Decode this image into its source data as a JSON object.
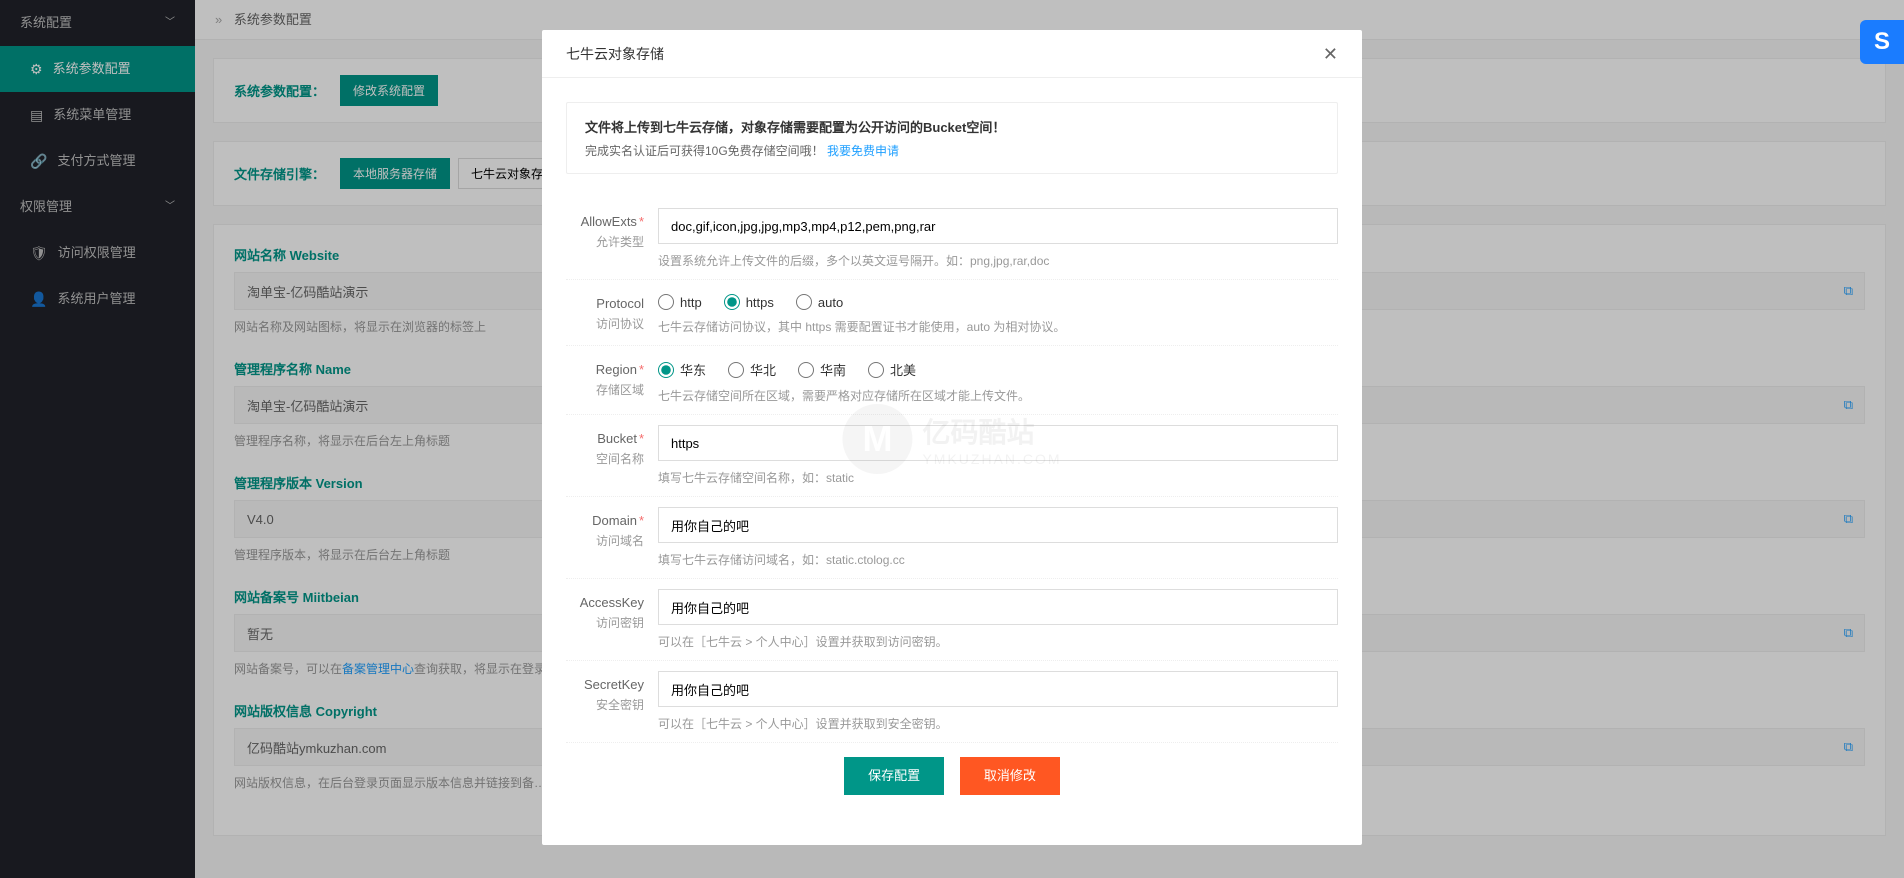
{
  "sidebar": {
    "group1": "系统配置",
    "items1": [
      "系统参数配置",
      "系统菜单管理",
      "支付方式管理"
    ],
    "group2": "权限管理",
    "items2": [
      "访问权限管理",
      "系统用户管理"
    ]
  },
  "breadcrumb": "系统参数配置",
  "panel1": {
    "label": "系统参数配置：",
    "btn": "修改系统配置"
  },
  "panel2": {
    "label": "文件存储引擎：",
    "btn1": "本地服务器存储",
    "btn2": "七牛云对象存储"
  },
  "fields": [
    {
      "label": "网站名称 Website",
      "value": "淘单宝-亿码酷站演示",
      "desc": "网站名称及网站图标，将显示在浏览器的标签上"
    },
    {
      "label": "管理程序名称 Name",
      "value": "淘单宝-亿码酷站演示",
      "desc": "管理程序名称，将显示在后台左上角标题"
    },
    {
      "label": "管理程序版本 Version",
      "value": "V4.0",
      "desc": "管理程序版本，将显示在后台左上角标题"
    },
    {
      "label": "网站备案号 Miitbeian",
      "value": "暂无",
      "desc": "网站备案号，可以在",
      "descLink": "备案管理中心",
      "desc2": "查询获取，将显示在登录……"
    },
    {
      "label": "网站版权信息 Copyright",
      "value": "亿码酷站ymkuzhan.com",
      "desc": "网站版权信息，在后台登录页面显示版本信息并链接到备……"
    }
  ],
  "modal": {
    "title": "七牛云对象存储",
    "info1": "文件将上传到七牛云存储，对象存储需要配置为公开访问的Bucket空间！",
    "info2a": "完成实名认证后可获得10G免费存储空间哦！",
    "info2b": "我要免费申请",
    "rows": [
      {
        "label": "AllowExts",
        "sub": "允许类型",
        "req": true,
        "type": "input",
        "value": "doc,gif,icon,jpg,jpg,mp3,mp4,p12,pem,png,rar",
        "desc": "设置系统允许上传文件的后缀，多个以英文逗号隔开。如：png,jpg,rar,doc"
      },
      {
        "label": "Protocol",
        "sub": "访问协议",
        "req": false,
        "type": "radio",
        "options": [
          "http",
          "https",
          "auto"
        ],
        "selected": 1,
        "desc": "七牛云存储访问协议，其中 https 需要配置证书才能使用，auto 为相对协议。"
      },
      {
        "label": "Region",
        "sub": "存储区域",
        "req": true,
        "type": "radio",
        "options": [
          "华东",
          "华北",
          "华南",
          "北美"
        ],
        "selected": 0,
        "desc": "七牛云存储空间所在区域，需要严格对应存储所在区域才能上传文件。"
      },
      {
        "label": "Bucket",
        "sub": "空间名称",
        "req": true,
        "type": "input",
        "value": "https",
        "desc": "填写七牛云存储空间名称，如：static"
      },
      {
        "label": "Domain",
        "sub": "访问域名",
        "req": true,
        "type": "input",
        "value": "用你自己的吧",
        "desc": "填写七牛云存储访问域名，如：static.ctolog.cc"
      },
      {
        "label": "AccessKey",
        "sub": "访问密钥",
        "req": false,
        "type": "input",
        "value": "用你自己的吧",
        "desc": "可以在［七牛云 > 个人中心］设置并获取到访问密钥。"
      },
      {
        "label": "SecretKey",
        "sub": "安全密钥",
        "req": false,
        "type": "input",
        "value": "用你自己的吧",
        "desc": "可以在［七牛云 > 个人中心］设置并获取到安全密钥。"
      }
    ],
    "btnSave": "保存配置",
    "btnCancel": "取消修改"
  },
  "watermark": {
    "text1": "亿码酷站",
    "text2": "YMKUZHAN.COM"
  }
}
